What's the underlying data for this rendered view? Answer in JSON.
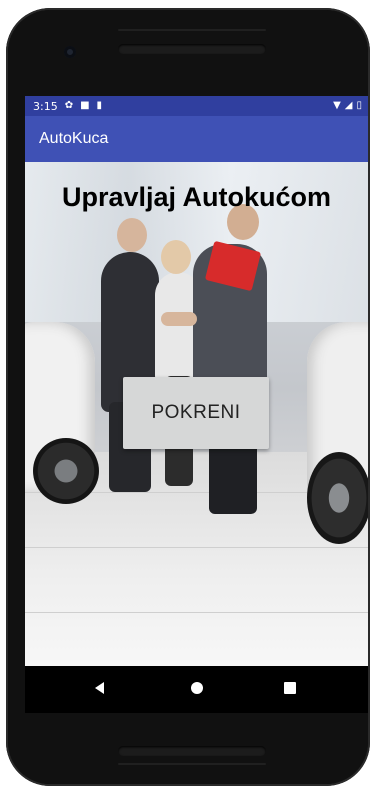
{
  "status_bar": {
    "time": "3:15",
    "icons": [
      "settings-icon",
      "sim-icon",
      "sd-card-icon"
    ],
    "right_icons": [
      "wifi-icon",
      "signal-icon",
      "battery-icon"
    ]
  },
  "app_bar": {
    "title": "AutoKuca"
  },
  "main": {
    "heading": "Upravljaj Autokućom",
    "start_button_label": "POKRENI"
  },
  "nav_bar": {
    "buttons": [
      "back",
      "home",
      "recents"
    ]
  },
  "colors": {
    "status_bar": "#303f9f",
    "app_bar": "#3f51b5",
    "button": "#d6d7d7"
  }
}
